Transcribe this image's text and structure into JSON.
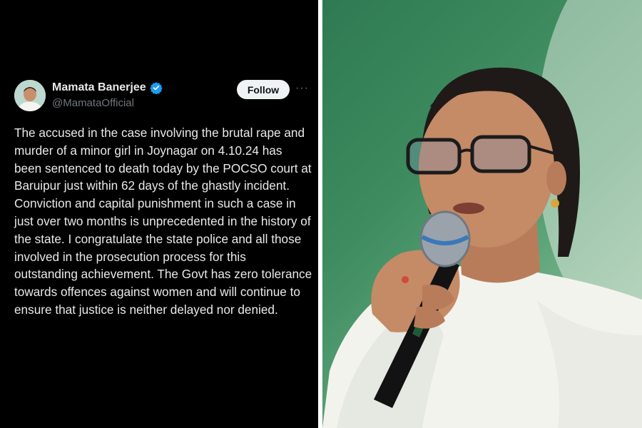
{
  "tweet": {
    "display_name": "Mamata Banerjee",
    "handle": "@MamataOfficial",
    "follow_label": "Follow",
    "more_label": "···",
    "text": "The accused in the case involving the brutal rape and murder of a minor girl in Joynagar on 4.10.24 has been sentenced to death today by the POCSO court at Baruipur just within 62 days of the ghastly incident. Conviction and capital punishment in such a case in just over two months is unprecedented in the history of the state. I congratulate the state police and all those involved in the prosecution process for this outstanding achievement. The Govt has zero tolerance towards offences against women and will continue to ensure that justice is neither delayed nor denied."
  },
  "colors": {
    "background": "#000000",
    "text": "#e7e9ea",
    "secondary_text": "#71767b",
    "verified_badge": "#1d9bf0",
    "follow_button": "#eff3f4"
  },
  "icons": {
    "verified": "verified-badge-icon",
    "more": "more-options-icon"
  }
}
